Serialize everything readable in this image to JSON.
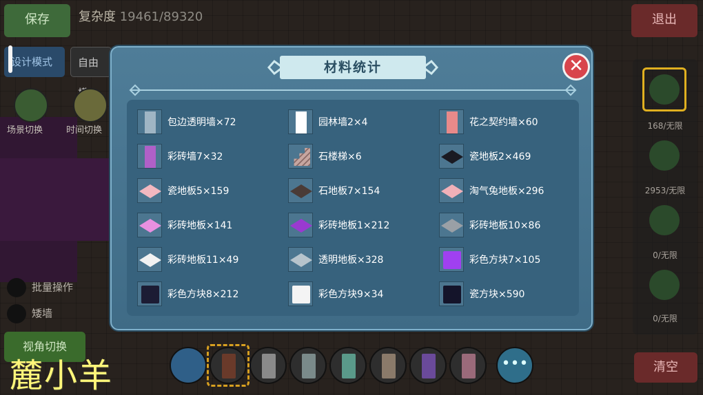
{
  "hud": {
    "save_label": "保存",
    "complexity_label": "复杂度",
    "complexity_value": "19461/89320",
    "exit_label": "退出",
    "clear_label": "清空",
    "mode_design": "设计模式",
    "mode_free": "自由模",
    "scene_switch": "场景切换",
    "time_switch": "时间切换",
    "batch_op": "批量操作",
    "short_wall": "矮墙",
    "view_switch": "视角切换",
    "right_counts": [
      "168/无限",
      "2953/无限",
      "0/无限",
      "0/无限"
    ],
    "more_label": "•••"
  },
  "watermark": "麓小羊",
  "modal": {
    "title": "材料统计",
    "close_label": "✕",
    "items": [
      {
        "label": "包边透明墙×72",
        "icon": "clear-wall-icon",
        "kind": "wall",
        "color": "#9fb5c4"
      },
      {
        "label": "园林墙2×4",
        "icon": "garden-wall-icon",
        "kind": "wall",
        "color": "#ffffff"
      },
      {
        "label": "花之契约墙×60",
        "icon": "flower-wall-icon",
        "kind": "wall",
        "color": "#e88a8a"
      },
      {
        "label": "彩砖墙7×32",
        "icon": "color-brick-wall-icon",
        "kind": "wall",
        "color": "#b060c8"
      },
      {
        "label": "石楼梯×6",
        "icon": "stone-stairs-icon",
        "kind": "stairs",
        "color": "#c6a6a0"
      },
      {
        "label": "瓷地板2×469",
        "icon": "porcelain-floor-dark-icon",
        "kind": "tile",
        "color": "#1a1a22"
      },
      {
        "label": "瓷地板5×159",
        "icon": "porcelain-floor-pink-icon",
        "kind": "tile",
        "color": "#f3b8c0"
      },
      {
        "label": "石地板7×154",
        "icon": "stone-floor-icon",
        "kind": "tile",
        "color": "#4a3b36"
      },
      {
        "label": "淘气兔地板×296",
        "icon": "bunny-floor-icon",
        "kind": "tile",
        "color": "#f0b0b8"
      },
      {
        "label": "彩砖地板×141",
        "icon": "color-brick-floor-pink-icon",
        "kind": "tile",
        "color": "#e890e0"
      },
      {
        "label": "彩砖地板1×212",
        "icon": "color-brick-floor-purple-icon",
        "kind": "tile",
        "color": "#9a3ad0"
      },
      {
        "label": "彩砖地板10×86",
        "icon": "color-brick-floor-gray-icon",
        "kind": "tile",
        "color": "#9aa0a6"
      },
      {
        "label": "彩砖地板11×49",
        "icon": "color-brick-floor-white-icon",
        "kind": "tile",
        "color": "#f2f2f2"
      },
      {
        "label": "透明地板×328",
        "icon": "clear-floor-icon",
        "kind": "tile",
        "color": "#b7c4cc"
      },
      {
        "label": "彩色方块7×105",
        "icon": "color-cube-purple-icon",
        "kind": "cube",
        "color": "#a040f0"
      },
      {
        "label": "彩色方块8×212",
        "icon": "color-cube-navy-icon",
        "kind": "cube",
        "color": "#1c1c34"
      },
      {
        "label": "彩色方块9×34",
        "icon": "color-cube-white-icon",
        "kind": "cube",
        "color": "#f4f4f4"
      },
      {
        "label": "瓷方块×590",
        "icon": "porcelain-cube-icon",
        "kind": "cube",
        "color": "#14142a"
      }
    ]
  }
}
